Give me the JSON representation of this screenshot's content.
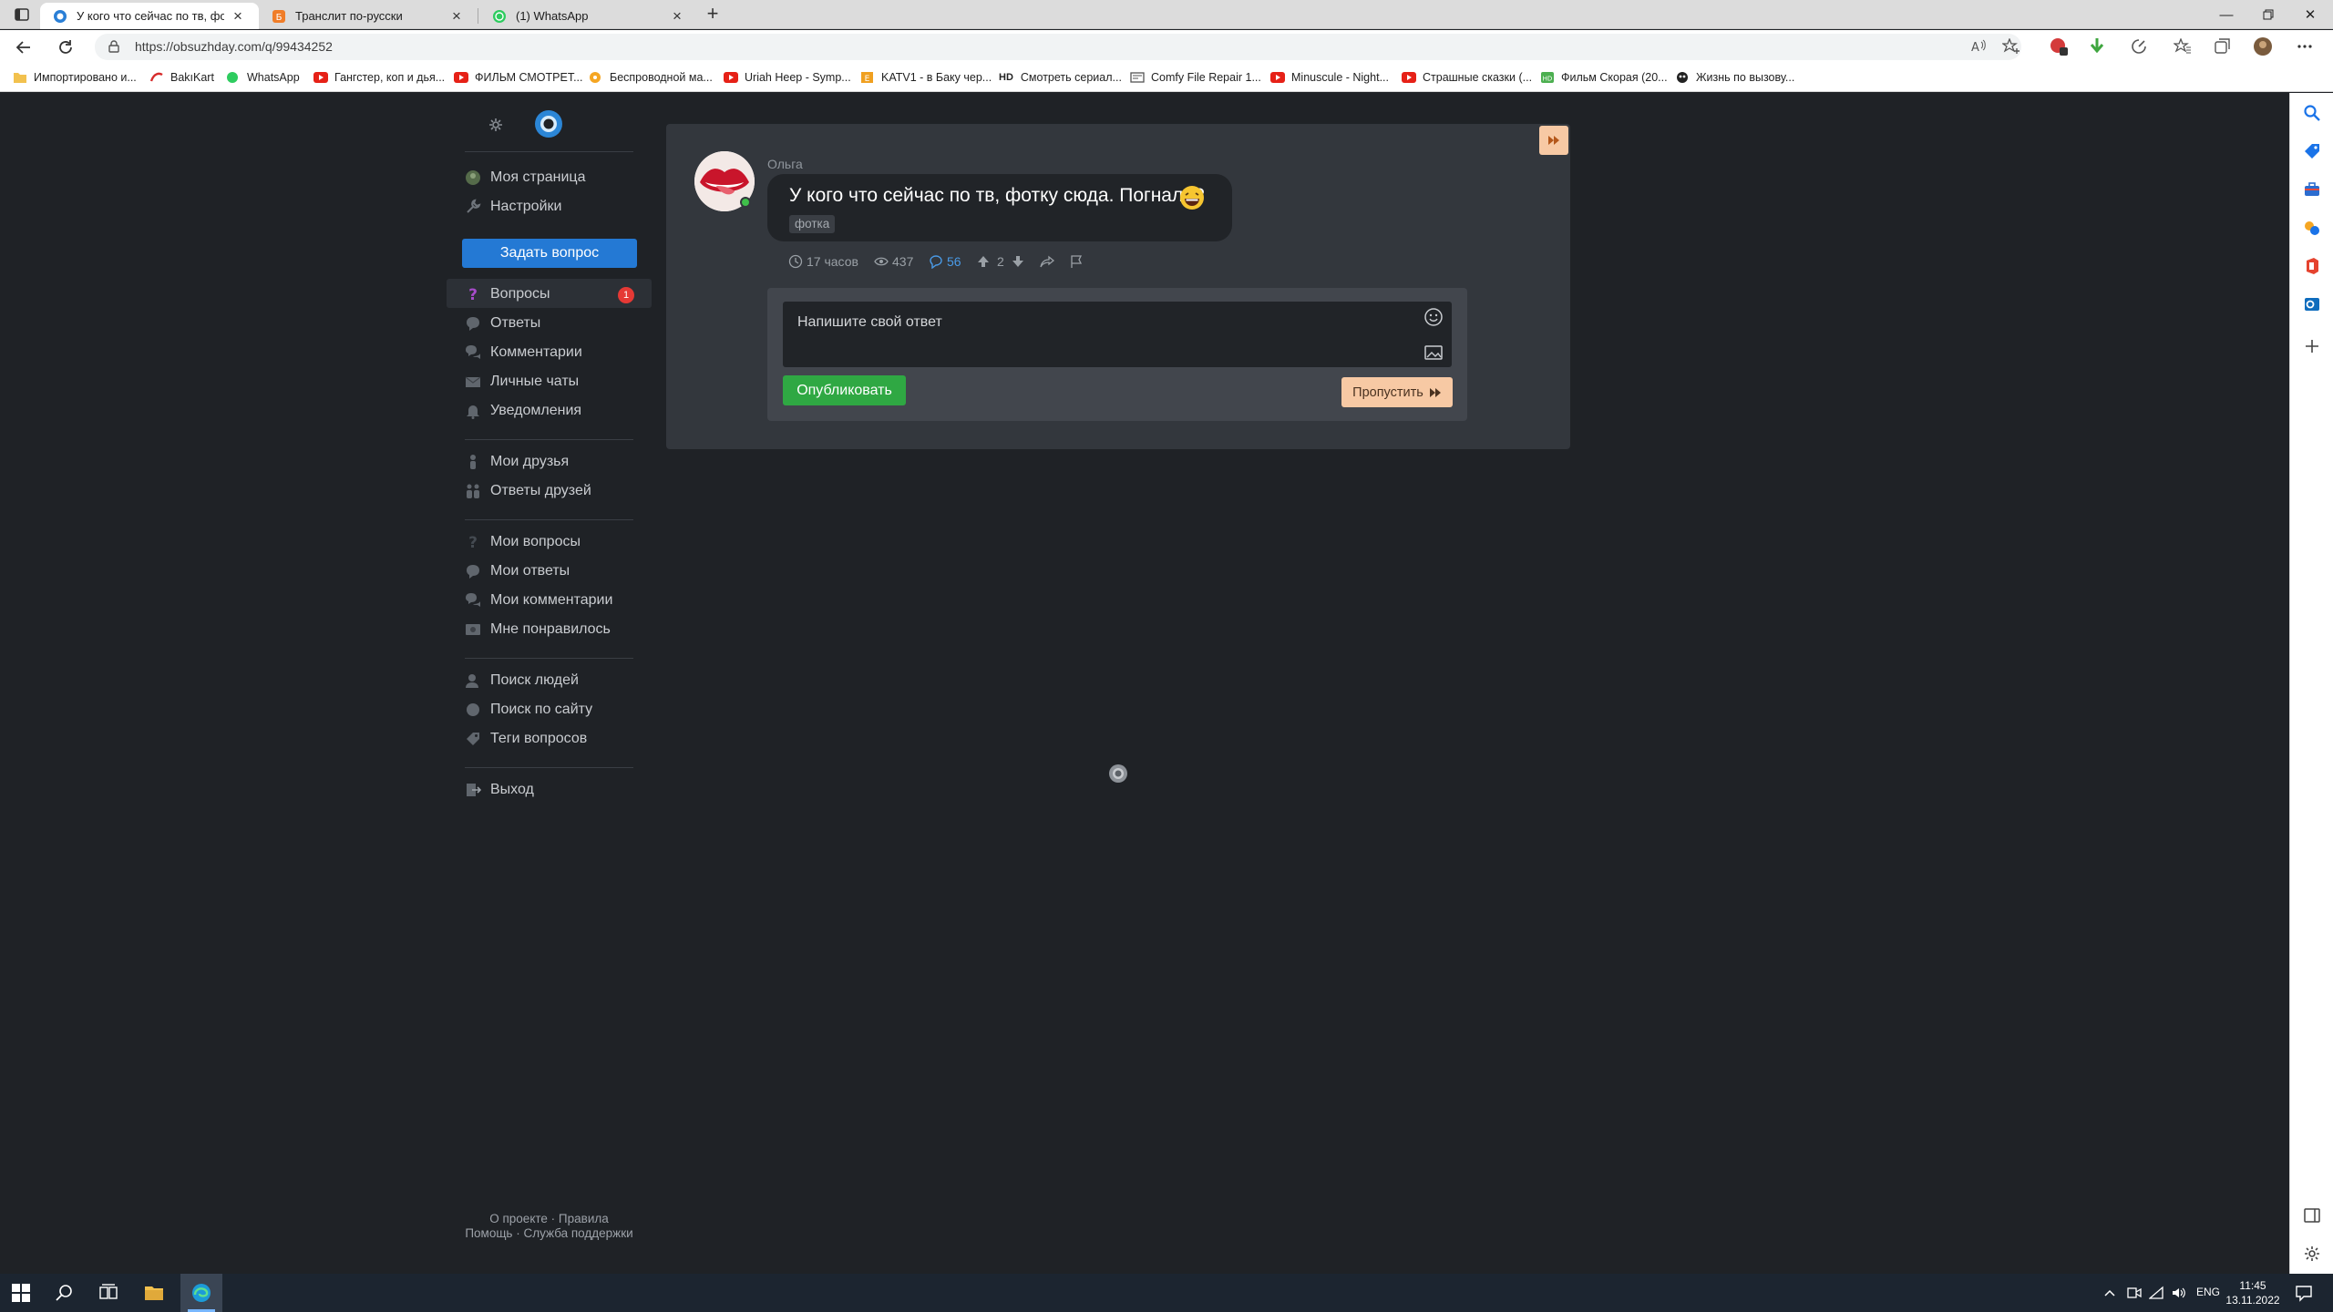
{
  "browser": {
    "tabs": [
      {
        "label": "У кого что сейчас по тв, фотку сюда",
        "active": true
      },
      {
        "label": "Транслит по-русски",
        "active": false
      },
      {
        "label": "(1) WhatsApp",
        "active": false
      }
    ],
    "url": "https://obsuzhday.com/q/99434252",
    "bookmarks": [
      "Импортировано и...",
      "BakıKart",
      "WhatsApp",
      "Гангстер, коп и дья...",
      "ФИЛЬМ СМОТРЕТ...",
      "Беспроводной ма...",
      "Uriah Heep - Symp...",
      "KATV1 - в Баку чер...",
      "Смотреть сериал...",
      "Comfy File Repair 1...",
      "Minuscule - Night...",
      "Страшные сказки (...",
      "Фильм Скорая (20...",
      "Жизнь по вызову..."
    ],
    "hd_badge": "HD"
  },
  "sidebar": {
    "primary": [
      {
        "label": "Моя страница"
      },
      {
        "label": "Настройки"
      }
    ],
    "ask_button": "Задать вопрос",
    "feeds": [
      {
        "label": "Вопросы",
        "badge": "1"
      },
      {
        "label": "Ответы"
      },
      {
        "label": "Комментарии"
      },
      {
        "label": "Личные чаты"
      },
      {
        "label": "Уведомления"
      }
    ],
    "friends": [
      {
        "label": "Мои друзья"
      },
      {
        "label": "Ответы друзей"
      }
    ],
    "mine": [
      {
        "label": "Мои вопросы"
      },
      {
        "label": "Мои ответы"
      },
      {
        "label": "Мои комментарии"
      },
      {
        "label": "Мне понравилось"
      }
    ],
    "search": [
      {
        "label": "Поиск людей"
      },
      {
        "label": "Поиск по сайту"
      },
      {
        "label": "Теги вопросов"
      }
    ],
    "logout": "Выход",
    "footer": {
      "about": "О проекте",
      "rules": "Правила",
      "help": "Помощь",
      "support": "Служба поддержки",
      "sep": " · "
    }
  },
  "question": {
    "author": "Ольга",
    "text": "У кого что сейчас по тв, фотку сюда. Погнали?",
    "tag": "фотка",
    "time": "17 часов",
    "views": "437",
    "comments": "56",
    "votes": "2"
  },
  "composer": {
    "placeholder": "Напишите свой ответ",
    "publish": "Опубликовать",
    "skip": "Пропустить"
  },
  "taskbar": {
    "lang": "ENG",
    "time": "11:45",
    "date": "13.11.2022"
  },
  "colors": {
    "accent_blue": "#2479d4",
    "publish_green": "#2fa843",
    "skip_peach": "#f7c9a4",
    "badge_red": "#e53935",
    "page_bg": "#1f2226",
    "card_bg": "#33373d"
  }
}
